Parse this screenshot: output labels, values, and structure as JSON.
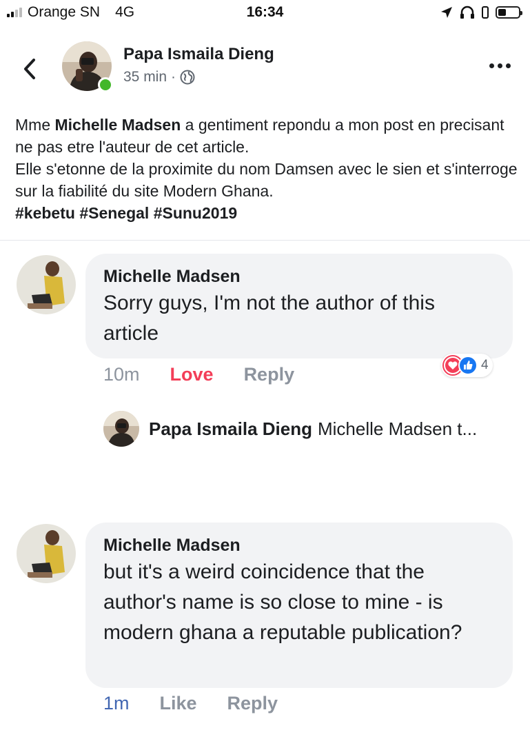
{
  "status_bar": {
    "carrier": "Orange SN",
    "network": "4G",
    "time": "16:34",
    "battery_level": 0.4
  },
  "post": {
    "author": "Papa Ismaila Dieng",
    "time": "35 min",
    "separator": "·",
    "privacy_icon": "globe-icon",
    "text_pre": "Mme ",
    "text_bold": "Michelle Madsen",
    "text_line1_rest": " a gentiment repondu a mon post en precisant ne pas etre l'auteur de cet article.",
    "text_line2": "Elle s'etonne de la proximite du nom Damsen avec le sien et s'interroge sur la fiabilité du site Modern Ghana.",
    "hashtags": "#kebetu #Senegal #Sunu2019"
  },
  "comments": [
    {
      "author": "Michelle Madsen",
      "text": "Sorry guys, I'm not the author of this article",
      "time": "10m",
      "reaction_action": "Love",
      "reply_label": "Reply",
      "reaction_count": "4",
      "reply_preview": {
        "author": "Papa Ismaila Dieng",
        "text": "Michelle Madsen t..."
      }
    },
    {
      "author": "Michelle Madsen",
      "text": "but it's a weird coincidence that the author's name is so close to mine - is modern ghana a reputable publication?",
      "time": "1m",
      "reaction_action": "Like",
      "reply_label": "Reply"
    }
  ],
  "colors": {
    "love": "#f33e58",
    "link_blue": "#4267b2",
    "bubble": "#f2f3f5",
    "online": "#42b72a"
  }
}
